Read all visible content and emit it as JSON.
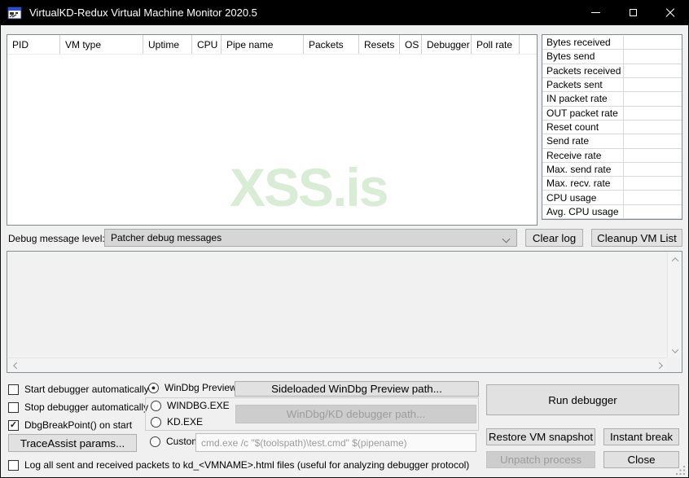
{
  "window": {
    "title": "VirtualKD-Redux Virtual Machine Monitor 2020.5",
    "icons": {
      "app": "app-icon",
      "minimize": "minimize-icon",
      "maximize": "maximize-icon",
      "close": "close-icon",
      "resize_grip": "resize-grip-icon"
    }
  },
  "vm_table": {
    "columns": [
      {
        "label": "PID"
      },
      {
        "label": "VM type"
      },
      {
        "label": "Uptime"
      },
      {
        "label": "CPU"
      },
      {
        "label": "Pipe name"
      },
      {
        "label": "Packets"
      },
      {
        "label": "Resets"
      },
      {
        "label": "OS"
      },
      {
        "label": "Debugger"
      },
      {
        "label": "Poll rate"
      }
    ],
    "rows": [],
    "watermark": "XSS.is",
    "watermark_color": "#d8ecd6"
  },
  "stats": {
    "rows": [
      {
        "label": "Bytes received",
        "value": ""
      },
      {
        "label": "Bytes send",
        "value": ""
      },
      {
        "label": "Packets received",
        "value": ""
      },
      {
        "label": "Packets sent",
        "value": ""
      },
      {
        "label": "IN packet rate",
        "value": ""
      },
      {
        "label": "OUT packet rate",
        "value": ""
      },
      {
        "label": "Reset count",
        "value": ""
      },
      {
        "label": "Send rate",
        "value": ""
      },
      {
        "label": "Receive rate",
        "value": ""
      },
      {
        "label": "Max. send rate",
        "value": ""
      },
      {
        "label": "Max. recv. rate",
        "value": ""
      },
      {
        "label": "CPU usage",
        "value": ""
      },
      {
        "label": "Avg. CPU usage",
        "value": ""
      }
    ]
  },
  "log_controls": {
    "label": "Debug message level:",
    "selected": "Patcher debug messages",
    "clear_log": "Clear log",
    "cleanup": "Cleanup VM List"
  },
  "log_area": {
    "content": ""
  },
  "options": {
    "checkboxes": [
      {
        "label": "Start debugger automatically",
        "checked": false,
        "glyph": ""
      },
      {
        "label": "Stop debugger automatically",
        "checked": false,
        "glyph": ""
      },
      {
        "label": "DbgBreakPoint() on start",
        "checked": true,
        "glyph": "✓"
      }
    ],
    "trace_button": "TraceAssist params...",
    "log_packets": {
      "label": "Log all sent and received packets to kd_<VMNAME>.html files (useful for analyzing debugger protocol)",
      "checked": false,
      "glyph": ""
    }
  },
  "debugger_select": {
    "radios": [
      {
        "label": "WinDbg Preview",
        "selected": true,
        "glyph": "●"
      },
      {
        "label": "WINDBG.EXE",
        "selected": false,
        "glyph": ""
      },
      {
        "label": "KD.EXE",
        "selected": false,
        "glyph": ""
      },
      {
        "label": "Custom:",
        "selected": false,
        "glyph": ""
      }
    ],
    "sideloaded_button": "Sideloaded WinDbg Preview path...",
    "path_button": "WinDbg/KD debugger path...",
    "path_button_enabled": false,
    "custom_command": "cmd.exe /c \"$(toolspath)\\test.cmd\" $(pipename)"
  },
  "actions": {
    "run": "Run debugger",
    "restore": "Restore VM snapshot",
    "instant": "Instant break",
    "unpatch": "Unpatch process",
    "unpatch_enabled": false,
    "close": "Close"
  },
  "colors": {
    "titlebar_bg": "#000000",
    "window_bg": "#f0f0f0",
    "panel_bg": "#ffffff",
    "watermark": "#d8ecd6"
  }
}
